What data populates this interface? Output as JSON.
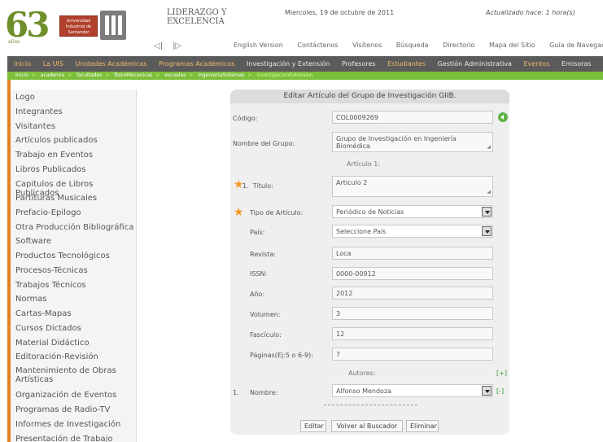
{
  "header": {
    "logo_number": "63",
    "logo_sub": "años",
    "university_badge": "Universidad Industrial de Santander",
    "title_line1": "LIDERAZGO Y",
    "title_line2": "EXCELENCIA",
    "date": "Miercoles, 19 de octubre de 2011",
    "updated": "Actualizado hace: 1 hora(s)"
  },
  "toplinks": [
    "English Version",
    "Contáctenos",
    "Visítenos",
    "Búsqueda",
    "Directorio",
    "Mapa del Sitio",
    "Guía de Navegación"
  ],
  "mainnav": [
    {
      "label": "Inicio",
      "color": "#f0b86a"
    },
    {
      "label": "La UIS",
      "color": "#f0b86a"
    },
    {
      "label": "Unidades Académicas",
      "color": "#f0b86a"
    },
    {
      "label": "Programas Académicos",
      "color": "#f0b86a"
    },
    {
      "label": "Investigación y Extensión",
      "color": "#e8e8e8"
    },
    {
      "label": "Profesores",
      "color": "#e8e8e8"
    },
    {
      "label": "Estudiantes",
      "color": "#f0b86a"
    },
    {
      "label": "Gestión Administrativa",
      "color": "#e8e8e8"
    },
    {
      "label": "Eventos",
      "color": "#f0b86a"
    },
    {
      "label": "Emisoras",
      "color": "#e8e8e8"
    }
  ],
  "breadcrumb": [
    "Inicio",
    "academia",
    "facultades",
    "fisicoMecanicas",
    "escuelas",
    "ingenieriaSistemas",
    "investigacionExtension"
  ],
  "sidebar": [
    "Logo",
    "Integrantes",
    "Visitantes",
    "Artículos publicados",
    "Trabajo en Eventos",
    "Libros Publicados",
    "Capitulos de Libros Publicados",
    "Partituras Musicales",
    "Prefacio-Epilogo",
    "Otra Producción Bibliográfica",
    "Software",
    "Productos Tecnológicos",
    "Procesos-Técnicas",
    "Trabajos Técnicos",
    "Normas",
    "Cartas-Mapas",
    "Cursos Dictados",
    "Material Didáctico",
    "Editoración-Revisión",
    "Mantenimiento de Obras Artísticas",
    "Organización de Eventos",
    "Programas de Radio-TV",
    "Informes de Investigación",
    "Presentación de Trabajo"
  ],
  "form": {
    "heading": "Editar Artículo del Grupo de Investigación GIIB.",
    "codigo_label": "Código:",
    "codigo_value": "COL0009269",
    "grupo_label": "Nombre del Grupo:",
    "grupo_value": "Grupo de Investigación en Ingeniería Biomédica",
    "articulo_heading": "Artículo 1:",
    "titulo_num": "1.",
    "titulo_label": "Título:",
    "titulo_value": "Articulo 2",
    "tipo_label": "Tipo de Artículo:",
    "tipo_value": "Periódico de Noticias",
    "pais_label": "País:",
    "pais_value": "Seleccione País",
    "revista_label": "Revista:",
    "revista_value": "Loca",
    "issn_label": "ISSN:",
    "issn_value": "0000-00912",
    "anio_label": "Año:",
    "anio_value": "2012",
    "volumen_label": "Volumen:",
    "volumen_value": "3",
    "fasciculo_label": "Fascículo:",
    "fasciculo_value": "12",
    "paginas_label": "Páginas(Ej:5 o 6-9):",
    "paginas_value": "7",
    "autores_heading": "Autores:",
    "add_author": "[+]",
    "autor_num": "1.",
    "autor_label": "Nombre:",
    "autor_value": "Alfonso Mendoza",
    "remove_author": "[-]",
    "btn_editar": "Editar",
    "btn_volver": "Volver al Buscador",
    "btn_eliminar": "Eliminar"
  }
}
